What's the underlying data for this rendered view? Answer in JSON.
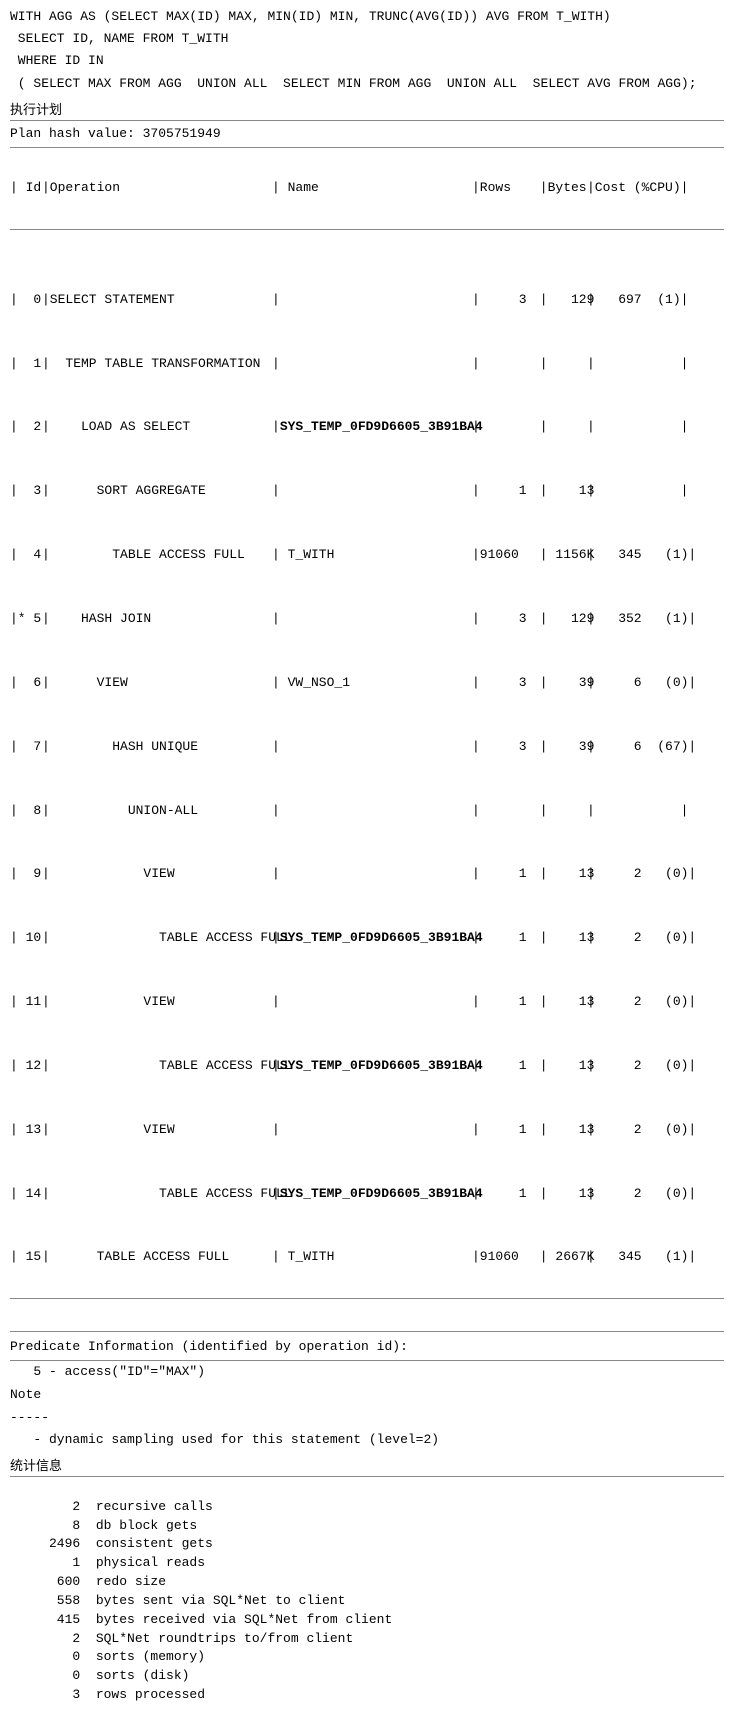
{
  "sql": {
    "line1": "WITH AGG AS (SELECT MAX(ID) MAX, MIN(ID) MIN, TRUNC(AVG(ID)) AVG FROM T_WITH)",
    "line2": " SELECT ID, NAME FROM T_WITH",
    "line3": " WHERE ID IN",
    "line4": " ( SELECT MAX FROM AGG  UNION ALL  SELECT MIN FROM AGG  UNION ALL  SELECT AVG FROM AGG);",
    "section_title": "执行计划"
  },
  "plan": {
    "hash_label": "Plan hash value: 3705751949",
    "header_divider": "--------------------------------------------------------------------------------",
    "columns": [
      "Id ",
      "Operation                        ",
      "Name                        ",
      "Rows  ",
      " Bytes",
      "Cost (%CPU)"
    ],
    "rows": [
      {
        "id": "  0",
        "marker": " ",
        "operation": "SELECT STATEMENT              ",
        "name": "                            ",
        "rows": "     3",
        "bytes": "   129",
        "cost": "697  (1)"
      },
      {
        "id": "  1",
        "marker": " ",
        "operation": "  TEMP TABLE TRANSFORMATION   ",
        "name": "                            ",
        "rows": "      ",
        "bytes": "      ",
        "cost": "        "
      },
      {
        "id": "  2",
        "marker": " ",
        "operation": "    LOAD AS SELECT            ",
        "name": "SYS_TEMP_0FD9D6605_3B91BA4  ",
        "rows": "      ",
        "bytes": "      ",
        "cost": "        ",
        "bold_name": true
      },
      {
        "id": "  3",
        "marker": " ",
        "operation": "      SORT AGGREGATE          ",
        "name": "                            ",
        "rows": "     1",
        "bytes": "    13",
        "cost": "        "
      },
      {
        "id": "  4",
        "marker": " ",
        "operation": "        TABLE ACCESS FULL     ",
        "name": "T_WITH                      ",
        "rows": " 91060",
        "bytes": " 1156K",
        "cost": "345   (1)"
      },
      {
        "id": "* 5",
        "marker": "*",
        "operation": "    HASH JOIN                 ",
        "name": "                            ",
        "rows": "     3",
        "bytes": "   129",
        "cost": "352   (1)"
      },
      {
        "id": "  6",
        "marker": " ",
        "operation": "      VIEW                    ",
        "name": "VW_NSO_1                    ",
        "rows": "     3",
        "bytes": "    39",
        "cost": "  6   (0)"
      },
      {
        "id": "  7",
        "marker": " ",
        "operation": "        HASH UNIQUE           ",
        "name": "                            ",
        "rows": "     3",
        "bytes": "    39",
        "cost": "  6  (67)"
      },
      {
        "id": "  8",
        "marker": " ",
        "operation": "          UNION-ALL           ",
        "name": "                            ",
        "rows": "      ",
        "bytes": "      ",
        "cost": "        "
      },
      {
        "id": "  9",
        "marker": " ",
        "operation": "            VIEW              ",
        "name": "                            ",
        "rows": "     1",
        "bytes": "    13",
        "cost": "  2   (0)"
      },
      {
        "id": " 10",
        "marker": " ",
        "operation": "              TABLE ACCESS FULL",
        "name": "SYS_TEMP_0FD9D6605_3B91BA4  ",
        "rows": "     1",
        "bytes": "    13",
        "cost": "  2   (0)",
        "bold_name": true
      },
      {
        "id": " 11",
        "marker": " ",
        "operation": "            VIEW              ",
        "name": "                            ",
        "rows": "     1",
        "bytes": "    13",
        "cost": "  2   (0)"
      },
      {
        "id": " 12",
        "marker": " ",
        "operation": "              TABLE ACCESS FULL",
        "name": "SYS_TEMP_0FD9D6605_3B91BA4  ",
        "rows": "     1",
        "bytes": "    13",
        "cost": "  2   (0)",
        "bold_name": true
      },
      {
        "id": " 13",
        "marker": " ",
        "operation": "            VIEW              ",
        "name": "                            ",
        "rows": "     1",
        "bytes": "    13",
        "cost": "  2   (0)"
      },
      {
        "id": " 14",
        "marker": " ",
        "operation": "              TABLE ACCESS FULL",
        "name": "SYS_TEMP_0FD9D6605_3B91BA4  ",
        "rows": "     1",
        "bytes": "    13",
        "cost": "  2   (0)",
        "bold_name": true
      },
      {
        "id": " 15",
        "marker": " ",
        "operation": "      TABLE ACCESS FULL       ",
        "name": "T_WITH                      ",
        "rows": " 91060",
        "bytes": " 2667K",
        "cost": "345   (1)"
      }
    ]
  },
  "predicate": {
    "title": "Predicate Information (identified by operation id):",
    "divider": "--------------------------------------------------------------------------------",
    "content": "   5 - access(\"ID\"=\"MAX\")",
    "note_label": "Note",
    "note_divider": "-----",
    "note_content": "   - dynamic sampling used for this statement (level=2)"
  },
  "stats": {
    "title": "统计信息",
    "divider": "--------------------------------------------------------------------------------",
    "items": [
      {
        "value": "       2",
        "label": "recursive calls"
      },
      {
        "value": "       8",
        "label": "db block gets"
      },
      {
        "value": "    2496",
        "label": "consistent gets"
      },
      {
        "value": "       1",
        "label": "physical reads"
      },
      {
        "value": "     600",
        "label": "redo size"
      },
      {
        "value": "     558",
        "label": "bytes sent via SQL*Net to client"
      },
      {
        "value": "     415",
        "label": "bytes received via SQL*Net from client"
      },
      {
        "value": "       2",
        "label": "SQL*Net roundtrips to/from client"
      },
      {
        "value": "       0",
        "label": "sorts (memory)"
      },
      {
        "value": "       0",
        "label": "sorts (disk)"
      },
      {
        "value": "       3",
        "label": "rows processed"
      }
    ]
  }
}
